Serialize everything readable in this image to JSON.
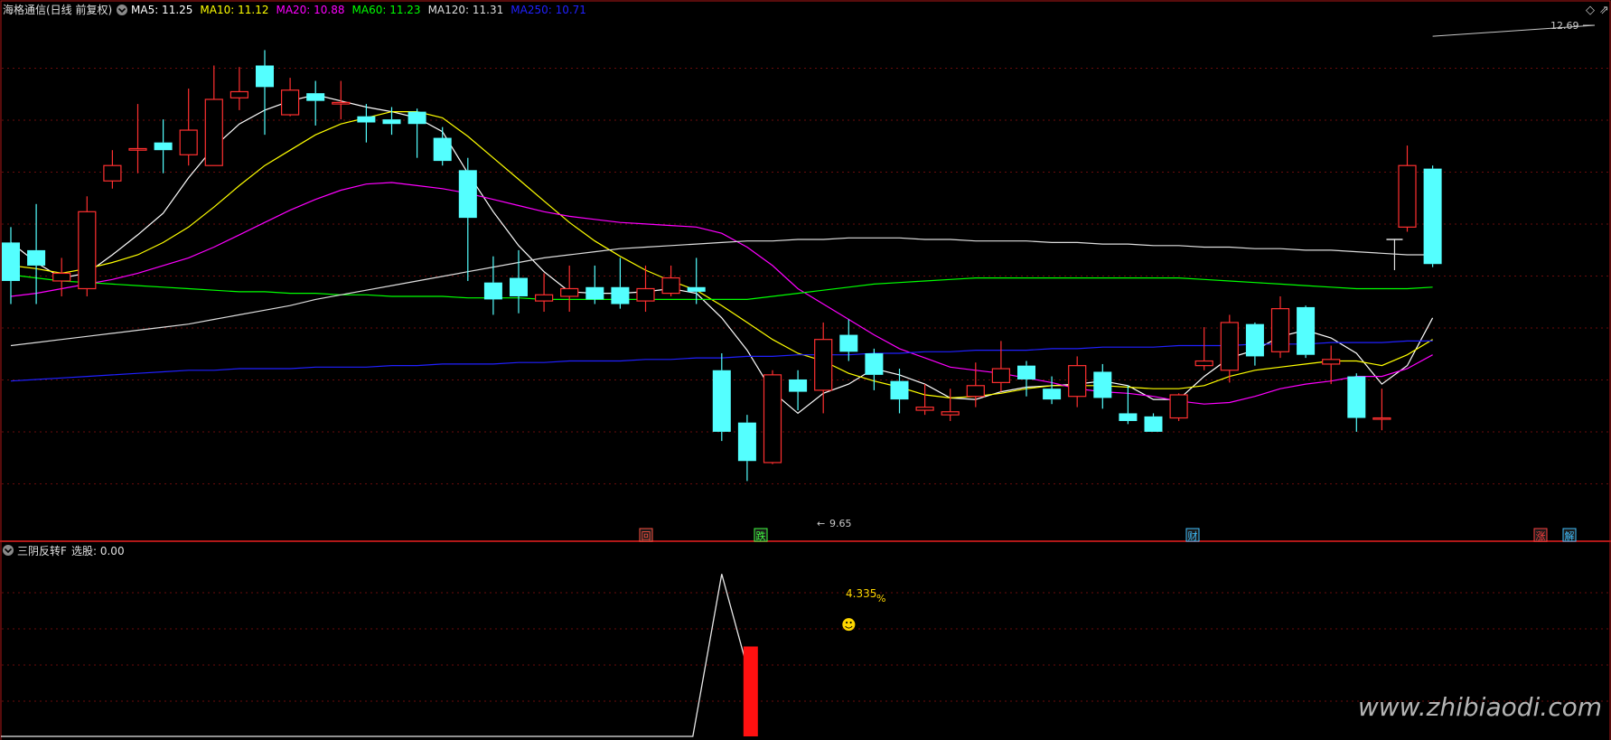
{
  "header": {
    "title": "海格通信(日线 前复权)",
    "ma": [
      {
        "label": "MA5: 11.25",
        "color": "#ffffff"
      },
      {
        "label": "MA10: 11.12",
        "color": "#ffff00"
      },
      {
        "label": "MA20: 10.88",
        "color": "#ff00ff"
      },
      {
        "label": "MA60: 11.23",
        "color": "#00ff00"
      },
      {
        "label": "MA120: 11.31",
        "color": "#dddddd"
      },
      {
        "label": "MA250: 10.71",
        "color": "#2020ff"
      }
    ]
  },
  "indicator": {
    "title": "三阴反转F",
    "label": "选股: 0.00",
    "percent_value": "4.335",
    "percent_sign": "%",
    "emoticon": "☻"
  },
  "markers": {
    "high_label": "12.69",
    "low_label": "9.65",
    "low_arrow": "←"
  },
  "events": [
    {
      "label": "回",
      "color": "#ff5040"
    },
    {
      "label": "跌",
      "color": "#40ff40"
    },
    {
      "label": "财",
      "color": "#40c0ff"
    },
    {
      "label": "涨",
      "color": "#ff4040"
    },
    {
      "label": "解",
      "color": "#40c0ff"
    }
  ],
  "watermark": "www.zhibiaodi.com",
  "icons": {
    "panel_toggle": "chevron-down-icon",
    "corner": "diamond-icon"
  },
  "colors": {
    "up": "#ff3030",
    "down": "#54ffff",
    "grid": "#7a1010",
    "border": "#b01818",
    "bg": "#000000"
  },
  "chart_data": {
    "type": "candlestick",
    "ylim": [
      9.45,
      12.82
    ],
    "candles": [
      [
        11.35,
        11.1,
        11.45,
        10.95
      ],
      [
        11.3,
        11.2,
        11.6,
        10.95
      ],
      [
        11.1,
        11.15,
        11.25,
        11.0
      ],
      [
        11.05,
        11.55,
        11.65,
        11.0
      ],
      [
        11.75,
        11.85,
        11.95,
        11.7
      ],
      [
        11.95,
        11.96,
        12.25,
        11.8
      ],
      [
        12.0,
        11.95,
        12.15,
        11.8
      ],
      [
        11.92,
        12.08,
        12.35,
        11.85
      ],
      [
        11.85,
        12.28,
        12.5,
        11.85
      ],
      [
        12.29,
        12.33,
        12.49,
        12.21
      ],
      [
        12.5,
        12.36,
        12.6,
        12.05
      ],
      [
        12.18,
        12.34,
        12.42,
        12.17
      ],
      [
        12.32,
        12.27,
        12.4,
        12.11
      ],
      [
        12.25,
        12.26,
        12.4,
        12.15
      ],
      [
        12.17,
        12.13,
        12.25,
        12.0
      ],
      [
        12.15,
        12.12,
        12.23,
        12.05
      ],
      [
        12.2,
        12.12,
        12.22,
        11.9
      ],
      [
        12.03,
        11.88,
        12.1,
        11.85
      ],
      [
        11.82,
        11.51,
        11.9,
        11.1
      ],
      [
        11.09,
        10.98,
        11.26,
        10.88
      ],
      [
        11.12,
        11.0,
        11.3,
        10.89
      ],
      [
        10.97,
        11.01,
        11.15,
        10.9
      ],
      [
        11.0,
        11.05,
        11.2,
        10.9
      ],
      [
        11.06,
        10.98,
        11.2,
        10.95
      ],
      [
        11.06,
        10.95,
        11.25,
        10.92
      ],
      [
        10.97,
        11.05,
        11.2,
        10.9
      ],
      [
        11.02,
        11.12,
        11.2,
        11.0
      ],
      [
        11.06,
        11.03,
        11.25,
        10.95
      ],
      [
        10.52,
        10.12,
        10.63,
        10.06
      ],
      [
        10.18,
        9.93,
        10.23,
        9.8
      ],
      [
        9.92,
        10.49,
        10.52,
        9.91
      ],
      [
        10.46,
        10.38,
        10.52,
        10.26
      ],
      [
        10.39,
        10.72,
        10.83,
        10.24
      ],
      [
        10.75,
        10.64,
        10.85,
        10.58
      ],
      [
        10.63,
        10.49,
        10.66,
        10.39
      ],
      [
        10.45,
        10.33,
        10.53,
        10.24
      ],
      [
        10.26,
        10.28,
        10.43,
        10.23
      ],
      [
        10.23,
        10.25,
        10.4,
        10.19
      ],
      [
        10.35,
        10.42,
        10.57,
        10.28
      ],
      [
        10.44,
        10.53,
        10.71,
        10.38
      ],
      [
        10.55,
        10.46,
        10.58,
        10.35
      ],
      [
        10.4,
        10.33,
        10.48,
        10.3
      ],
      [
        10.35,
        10.55,
        10.61,
        10.28
      ],
      [
        10.51,
        10.34,
        10.56,
        10.27
      ],
      [
        10.24,
        10.19,
        10.42,
        10.17
      ],
      [
        10.22,
        10.12,
        10.24,
        10.12
      ],
      [
        10.21,
        10.36,
        10.37,
        10.19
      ],
      [
        10.55,
        10.58,
        10.8,
        10.52
      ],
      [
        10.52,
        10.83,
        10.88,
        10.44
      ],
      [
        10.82,
        10.61,
        10.83,
        10.55
      ],
      [
        10.64,
        10.92,
        11.0,
        10.6
      ],
      [
        10.93,
        10.62,
        10.94,
        10.6
      ],
      [
        10.56,
        10.59,
        10.68,
        10.43
      ],
      [
        10.48,
        10.21,
        10.5,
        10.12
      ],
      [
        10.21,
        10.21,
        10.4,
        10.13
      ],
      [
        11.45,
        11.85,
        11.98,
        11.42
      ],
      [
        11.83,
        11.21,
        11.85,
        11.19
      ]
    ],
    "ma_series": [
      {
        "name": "MA5",
        "color": "#ffffff",
        "values": [
          11.35,
          11.22,
          11.12,
          11.15,
          11.27,
          11.4,
          11.54,
          11.77,
          11.97,
          12.12,
          12.21,
          12.27,
          12.31,
          12.27,
          12.23,
          12.2,
          12.16,
          12.07,
          11.8,
          11.55,
          11.33,
          11.16,
          11.03,
          11.02,
          11.02,
          11.03,
          11.05,
          11.02,
          10.86,
          10.65,
          10.38,
          10.24,
          10.37,
          10.43,
          10.53,
          10.49,
          10.43,
          10.34,
          10.33,
          10.38,
          10.41,
          10.42,
          10.43,
          10.45,
          10.42,
          10.33,
          10.33,
          10.48,
          10.6,
          10.65,
          10.74,
          10.78,
          10.73,
          10.63,
          10.43,
          10.55,
          10.86
        ]
      },
      {
        "name": "MA10",
        "color": "#ffff00",
        "values": [
          11.2,
          11.18,
          11.15,
          11.18,
          11.22,
          11.27,
          11.35,
          11.45,
          11.58,
          11.72,
          11.85,
          11.95,
          12.05,
          12.12,
          12.16,
          12.2,
          12.2,
          12.16,
          12.04,
          11.9,
          11.76,
          11.62,
          11.48,
          11.36,
          11.26,
          11.17,
          11.1,
          11.04,
          10.94,
          10.83,
          10.72,
          10.63,
          10.58,
          10.5,
          10.45,
          10.41,
          10.36,
          10.34,
          10.35,
          10.37,
          10.4,
          10.42,
          10.42,
          10.42,
          10.41,
          10.4,
          10.4,
          10.42,
          10.48,
          10.52,
          10.54,
          10.56,
          10.58,
          10.58,
          10.55,
          10.62,
          10.72
        ]
      },
      {
        "name": "MA20",
        "color": "#ff00ff",
        "values": [
          11.0,
          11.02,
          11.05,
          11.08,
          11.11,
          11.15,
          11.2,
          11.25,
          11.32,
          11.4,
          11.48,
          11.56,
          11.63,
          11.69,
          11.73,
          11.74,
          11.72,
          11.7,
          11.67,
          11.63,
          11.59,
          11.55,
          11.52,
          11.5,
          11.48,
          11.47,
          11.46,
          11.45,
          11.41,
          11.32,
          11.2,
          11.05,
          10.95,
          10.85,
          10.75,
          10.66,
          10.6,
          10.54,
          10.52,
          10.5,
          10.47,
          10.44,
          10.4,
          10.38,
          10.37,
          10.35,
          10.32,
          10.3,
          10.31,
          10.35,
          10.4,
          10.43,
          10.45,
          10.48,
          10.48,
          10.53,
          10.62
        ]
      },
      {
        "name": "MA60",
        "color": "#00ff00",
        "values": [
          11.14,
          11.12,
          11.1,
          11.09,
          11.08,
          11.07,
          11.06,
          11.05,
          11.04,
          11.03,
          11.03,
          11.02,
          11.02,
          11.01,
          11.01,
          11.0,
          11.0,
          11.0,
          10.99,
          10.99,
          10.99,
          10.98,
          10.98,
          10.98,
          10.98,
          10.98,
          10.98,
          10.98,
          10.98,
          10.98,
          11.0,
          11.02,
          11.04,
          11.06,
          11.08,
          11.09,
          11.1,
          11.11,
          11.12,
          11.12,
          11.12,
          11.12,
          11.12,
          11.12,
          11.12,
          11.12,
          11.12,
          11.11,
          11.1,
          11.09,
          11.08,
          11.07,
          11.06,
          11.05,
          11.05,
          11.05,
          11.06
        ]
      },
      {
        "name": "MA120",
        "color": "#dddddd",
        "values": [
          10.68,
          10.7,
          10.72,
          10.74,
          10.76,
          10.78,
          10.8,
          10.82,
          10.85,
          10.88,
          10.91,
          10.94,
          10.98,
          11.01,
          11.04,
          11.07,
          11.1,
          11.13,
          11.16,
          11.19,
          11.22,
          11.25,
          11.27,
          11.29,
          11.31,
          11.32,
          11.33,
          11.34,
          11.35,
          11.36,
          11.36,
          11.37,
          11.37,
          11.38,
          11.38,
          11.38,
          11.37,
          11.37,
          11.36,
          11.36,
          11.36,
          11.35,
          11.35,
          11.34,
          11.34,
          11.33,
          11.33,
          11.32,
          11.32,
          11.31,
          11.31,
          11.3,
          11.3,
          11.29,
          11.28,
          11.27,
          11.27
        ]
      },
      {
        "name": "MA250",
        "color": "#2020ff",
        "values": [
          10.45,
          10.46,
          10.47,
          10.48,
          10.49,
          10.5,
          10.51,
          10.52,
          10.52,
          10.53,
          10.53,
          10.53,
          10.54,
          10.54,
          10.54,
          10.55,
          10.55,
          10.56,
          10.56,
          10.56,
          10.57,
          10.57,
          10.58,
          10.58,
          10.58,
          10.59,
          10.59,
          10.6,
          10.6,
          10.61,
          10.61,
          10.62,
          10.62,
          10.62,
          10.63,
          10.63,
          10.64,
          10.64,
          10.65,
          10.65,
          10.65,
          10.66,
          10.66,
          10.67,
          10.67,
          10.67,
          10.68,
          10.68,
          10.68,
          10.69,
          10.69,
          10.69,
          10.7,
          10.7,
          10.7,
          10.71,
          10.71
        ]
      }
    ],
    "extra_candle": {
      "value": 11.37
    },
    "high": 12.69,
    "low": 9.65,
    "indicator_series": {
      "ylim": [
        0,
        4.8
      ],
      "signal_index": 28,
      "spike_value": 4.335,
      "bar_value": 2.4
    }
  }
}
